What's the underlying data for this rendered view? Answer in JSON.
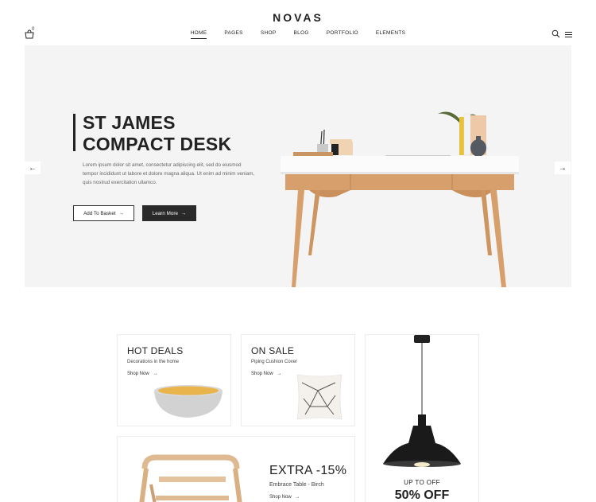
{
  "header": {
    "logo": "NOVAS",
    "cart_count": "0",
    "nav": [
      "HOME",
      "PAGES",
      "SHOP",
      "BLOG",
      "PORTFOLIO",
      "ELEMENTS"
    ]
  },
  "hero": {
    "title_line1": "ST JAMES",
    "title_line2": "COMPACT DESK",
    "description": "Lorem ipsum dolor sit amet, consectetur adipiscing elit, sed do eiusmod tempor incididunt ut labore et dolore magna aliqua. Ut enim ad minim veniam, quis nostrud exercitation ullamco.",
    "add_to_basket": "Add To Basket",
    "learn_more": "Learn More",
    "prev_arrow": "←",
    "next_arrow": "→"
  },
  "promos": {
    "hot_deals": {
      "title": "HOT DEALS",
      "subtitle": "Decorations in the home",
      "link": "Shop Now"
    },
    "on_sale": {
      "title": "ON SALE",
      "subtitle": "Piping Cushion Cover",
      "link": "Shop Now"
    },
    "lamp": {
      "upto": "UP TO OFF",
      "percent": "50% OFF"
    },
    "extra": {
      "title": "EXTRA -15%",
      "subtitle": "Embrace Table - Birch",
      "link": "Shop Now"
    }
  },
  "colors": {
    "accent": "#2a2a2a",
    "hero_bg": "#f4f4f4",
    "bowl_inner": "#e9b44c"
  }
}
